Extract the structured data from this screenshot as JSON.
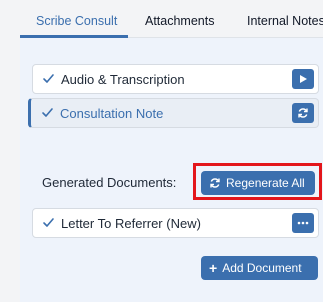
{
  "tabs": [
    {
      "label": "Scribe Consult",
      "active": true
    },
    {
      "label": "Attachments",
      "active": false
    },
    {
      "label": "Internal Notes",
      "active": false
    }
  ],
  "sections": [
    {
      "label": "Audio & Transcription",
      "action_icon": "play-icon",
      "selected": false
    },
    {
      "label": "Consultation Note",
      "action_icon": "refresh-icon",
      "selected": true
    }
  ],
  "generated": {
    "label": "Generated Documents:",
    "regenerate_label": "Regenerate All",
    "documents": [
      {
        "label": "Letter To Referrer (New)",
        "action_icon": "more-icon"
      }
    ],
    "add_label": "Add Document"
  },
  "colors": {
    "accent": "#3b6fae",
    "highlight": "#e3161b",
    "panel_bg": "#eef3fb",
    "page_bg": "#f3f4f6"
  }
}
